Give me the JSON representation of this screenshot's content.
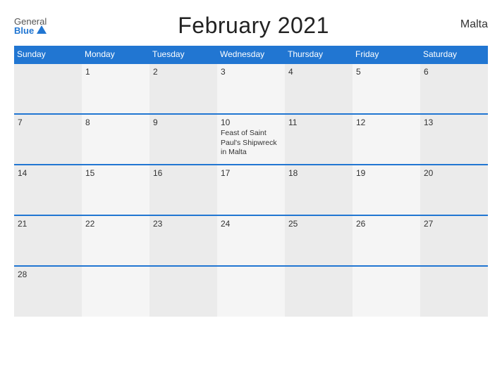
{
  "header": {
    "logo_general": "General",
    "logo_blue": "Blue",
    "title": "February 2021",
    "country": "Malta"
  },
  "days_of_week": [
    "Sunday",
    "Monday",
    "Tuesday",
    "Wednesday",
    "Thursday",
    "Friday",
    "Saturday"
  ],
  "weeks": [
    [
      {
        "day": "",
        "event": ""
      },
      {
        "day": "1",
        "event": ""
      },
      {
        "day": "2",
        "event": ""
      },
      {
        "day": "3",
        "event": ""
      },
      {
        "day": "4",
        "event": ""
      },
      {
        "day": "5",
        "event": ""
      },
      {
        "day": "6",
        "event": ""
      }
    ],
    [
      {
        "day": "7",
        "event": ""
      },
      {
        "day": "8",
        "event": ""
      },
      {
        "day": "9",
        "event": ""
      },
      {
        "day": "10",
        "event": "Feast of Saint Paul's Shipwreck in Malta"
      },
      {
        "day": "11",
        "event": ""
      },
      {
        "day": "12",
        "event": ""
      },
      {
        "day": "13",
        "event": ""
      }
    ],
    [
      {
        "day": "14",
        "event": ""
      },
      {
        "day": "15",
        "event": ""
      },
      {
        "day": "16",
        "event": ""
      },
      {
        "day": "17",
        "event": ""
      },
      {
        "day": "18",
        "event": ""
      },
      {
        "day": "19",
        "event": ""
      },
      {
        "day": "20",
        "event": ""
      }
    ],
    [
      {
        "day": "21",
        "event": ""
      },
      {
        "day": "22",
        "event": ""
      },
      {
        "day": "23",
        "event": ""
      },
      {
        "day": "24",
        "event": ""
      },
      {
        "day": "25",
        "event": ""
      },
      {
        "day": "26",
        "event": ""
      },
      {
        "day": "27",
        "event": ""
      }
    ],
    [
      {
        "day": "28",
        "event": ""
      },
      {
        "day": "",
        "event": ""
      },
      {
        "day": "",
        "event": ""
      },
      {
        "day": "",
        "event": ""
      },
      {
        "day": "",
        "event": ""
      },
      {
        "day": "",
        "event": ""
      },
      {
        "day": "",
        "event": ""
      }
    ]
  ]
}
